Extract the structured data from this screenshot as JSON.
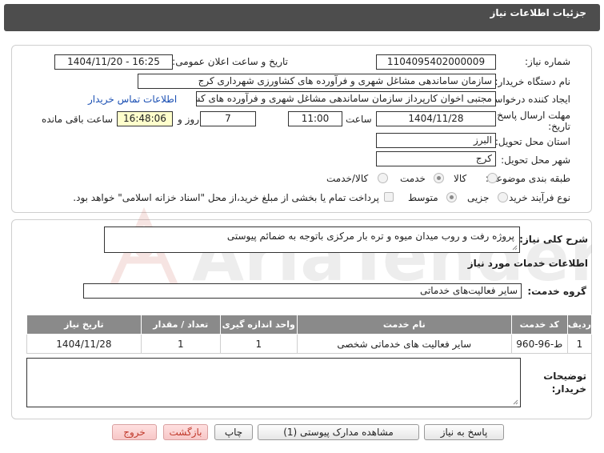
{
  "header": {
    "title": "جزئیات اطلاعات نیاز"
  },
  "form": {
    "need_number_label": "شماره نیاز:",
    "need_number_value": "1104095402000009",
    "announce_label": "تاریخ و ساعت اعلان عمومی:",
    "announce_value": "1404/11/20 - 16:25",
    "buyer_org_label": "نام دستگاه خریدار:",
    "buyer_org_value": "سازمان ساماندهی مشاغل شهری و فرآورده های کشاورزی شهرداری کرج",
    "requester_label": "ایجاد کننده درخواست:",
    "requester_value": "مجتبی اخوان کارپرداز سازمان ساماندهی مشاغل شهری و فرآورده های کشاورزی",
    "contact_link": "اطلاعات تماس خریدار",
    "deadline_label_1": "مهلت ارسال پاسخ: تا",
    "deadline_label_2": "تاریخ:",
    "deadline_date": "1404/11/28",
    "time_label": "ساعت",
    "deadline_time": "11:00",
    "days_value": "7",
    "days_label": "روز و",
    "remaining_time": "16:48:06",
    "remaining_label": "ساعت باقی مانده",
    "province_label": "استان محل تحویل:",
    "province_value": "البرز",
    "city_label": "شهر محل تحویل:",
    "city_value": "کرج",
    "category_label": "طبقه بندی موضوعی:",
    "category_options": [
      "کالا",
      "خدمت",
      "کالا/خدمت"
    ],
    "category_selected": "خدمت",
    "process_label": "نوع فرآیند خرید :",
    "process_options": [
      "جزیی",
      "متوسط"
    ],
    "process_selected": "متوسط",
    "payment_note": "پرداخت تمام یا بخشی از مبلغ خرید،از محل \"اسناد خزانه اسلامی\" خواهد بود."
  },
  "description": {
    "label": "شرح کلی نیاز:",
    "value": "پروژه رفت و روب میدان میوه و تره بار مرکزی باتوجه به ضمائم پیوستی"
  },
  "services": {
    "section_title": "اطلاعات خدمات مورد نیاز",
    "group_label": "گروه خدمت:",
    "group_value": "سایر فعالیت‌های خدماتی",
    "columns": [
      "ردیف",
      "کد خدمت",
      "نام خدمت",
      "واحد اندازه گیری",
      "تعداد / مقدار",
      "تاریخ نیاز"
    ],
    "rows": [
      [
        "1",
        "ط-96-960",
        "سایر فعالیت های خدماتی شخصی",
        "1",
        "1",
        "1404/11/28"
      ]
    ]
  },
  "buyer_notes": {
    "label_1": "توضیحات",
    "label_2": "خریدار:",
    "value": ""
  },
  "buttons": {
    "reply": "پاسخ به نیاز",
    "attachments": "مشاهده مدارک پیوستی (1)",
    "print": "چاپ",
    "back": "بازگشت",
    "exit": "خروج"
  },
  "watermark": {
    "text": "AriaTender.net"
  },
  "colors": {
    "header_bg": "#4d4d4d",
    "table_header_bg": "#8a8a8a",
    "highlight": "#ffffcc",
    "link": "#1a4fb3"
  }
}
